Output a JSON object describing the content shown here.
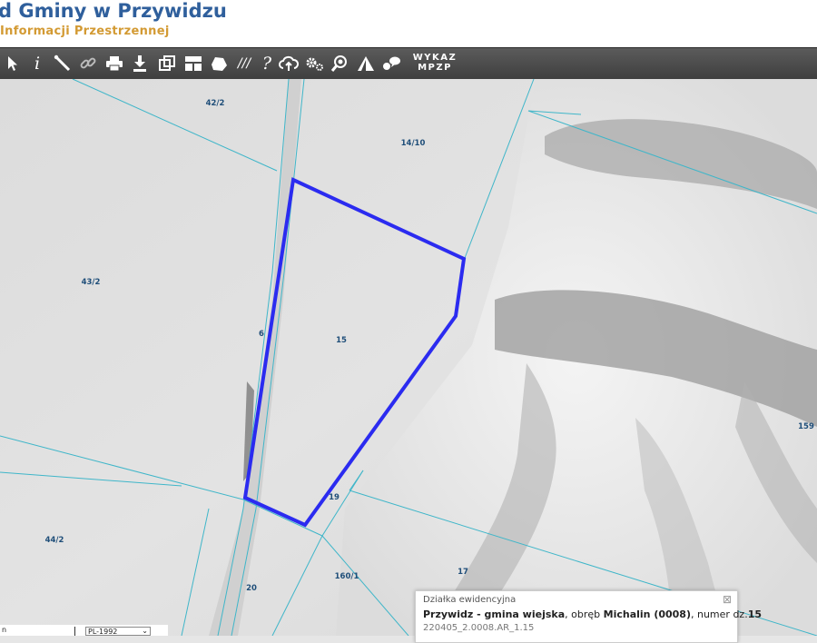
{
  "header": {
    "title": "d Gminy w Przywidzu",
    "subtitle": "Informacji Przestrzennej"
  },
  "toolbar": {
    "tools": [
      {
        "icon": "pointer-arrow-icon",
        "glyph": "➚"
      },
      {
        "icon": "info-icon",
        "glyph": "i"
      },
      {
        "icon": "measure-line-icon",
        "glyph": "╲"
      },
      {
        "icon": "link-icon",
        "glyph": "⛓"
      },
      {
        "icon": "print-icon",
        "glyph": "⎙"
      },
      {
        "icon": "download-icon",
        "glyph": "⤓"
      },
      {
        "icon": "copy-icon",
        "glyph": "❐"
      },
      {
        "icon": "layout-icon",
        "glyph": "▦"
      },
      {
        "icon": "polygon-icon",
        "glyph": "⬟"
      },
      {
        "icon": "hatch-icon",
        "glyph": "///"
      },
      {
        "icon": "help-icon",
        "glyph": "?"
      },
      {
        "icon": "cloud-upload-icon",
        "glyph": "☁"
      },
      {
        "icon": "settings-icon",
        "glyph": "⚙"
      },
      {
        "icon": "zoom-search-icon",
        "glyph": "⚲"
      },
      {
        "icon": "triangle-layer-icon",
        "glyph": "◭"
      },
      {
        "icon": "comment-icon",
        "glyph": "💬"
      }
    ],
    "wykaz_line1": "WYKAZ",
    "wykaz_line2": "MPZP"
  },
  "map": {
    "parcel_labels": [
      {
        "text": "42/2"
      },
      {
        "text": "14/10"
      },
      {
        "text": "43/2"
      },
      {
        "text": "6"
      },
      {
        "text": "15"
      },
      {
        "text": "159"
      },
      {
        "text": "19"
      },
      {
        "text": "44/2"
      },
      {
        "text": "160/1"
      },
      {
        "text": "17"
      },
      {
        "text": "20"
      }
    ],
    "selected_parcel": "15",
    "highlight_color": "#2b2bf0",
    "boundary_color": "#3fb6c9"
  },
  "popup": {
    "heading": "Działka ewidencyjna",
    "place": "Przywidz - gmina wiejska",
    "obreb_prefix": ", obręb ",
    "obreb": "Michalin (0008)",
    "numer_prefix": ", numer dz.",
    "numer": "15",
    "id": "220405_2.0008.AR_1.15",
    "close_glyph": "⊠"
  },
  "footer": {
    "crs": "PL-1992",
    "left_text": "n"
  }
}
